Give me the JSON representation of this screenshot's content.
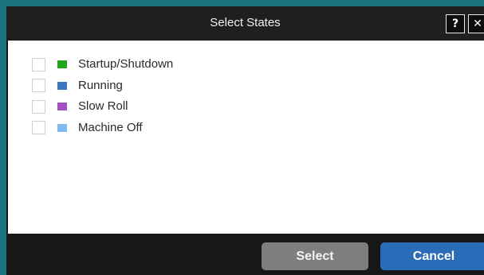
{
  "dialog": {
    "title": "Select States",
    "help_label": "?",
    "close_label": "✕"
  },
  "states": [
    {
      "label": "Startup/Shutdown",
      "color": "#22a618",
      "checked": false
    },
    {
      "label": "Running",
      "color": "#3b74bf",
      "checked": false
    },
    {
      "label": "Slow Roll",
      "color": "#a24fc1",
      "checked": false
    },
    {
      "label": "Machine Off",
      "color": "#7fbaf0",
      "checked": false
    }
  ],
  "footer": {
    "select_label": "Select",
    "cancel_label": "Cancel"
  },
  "colors": {
    "frame_accent": "#1c7481",
    "select_button": "#7e7e7e",
    "cancel_button": "#2b6cb8"
  }
}
